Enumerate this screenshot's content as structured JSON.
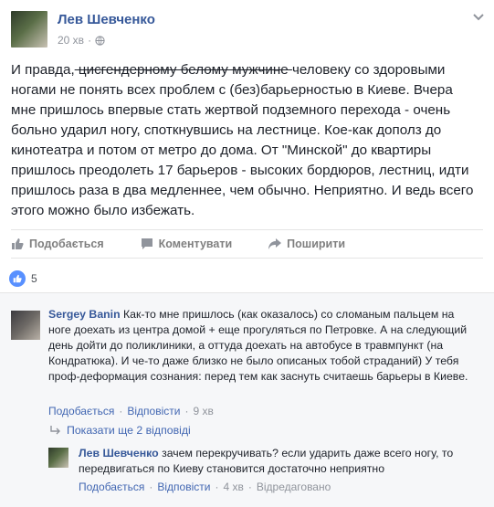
{
  "post": {
    "author": "Лев Шевченко",
    "time": "20 хв",
    "body": {
      "before_strike": "И правда,",
      "strike": " цисгендерному белому мужчине ",
      "after_strike": "человеку со здоровыми ногами не понять всех проблем с (без)барьерностью в Киеве. Вчера мне пришлось впервые стать жертвой подземного перехода - очень больно ударил ногу, споткнувшись на лестнице. Кое-как дополз до кинотеатра и потом от метро до дома. От \"Минской\" до квартиры пришлось преодолеть 17 барьеров - высоких бордюров, лестниц, идти пришлось раза в два медленнее, чем обычно. Неприятно. И ведь всего этого можно было избежать."
    },
    "actions": {
      "like": "Подобається",
      "comment": "Коментувати",
      "share": "Поширити"
    },
    "reaction_count": "5"
  },
  "comments": [
    {
      "author": "Sergey Banin",
      "text": "Как-то мне пришлось (как оказалось) со сломаным пальцем на ноге доехать из центра домой + еще прогуляться по Петровке. А на следующий день дойти до поликлиники, а оттуда доехать на автобусе в травмпункт (на Кондратюка). И че-то даже близко не было описаных тобой страданий) У тебя проф-деформация сознания: перед тем как заснуть считаешь барьеры в Киеве.",
      "like": "Подобається",
      "reply": "Відповісти",
      "time": "9 хв"
    }
  ],
  "show_more_replies": "Показати ще 2 відповіді",
  "reply": {
    "author": "Лев Шевченко",
    "text": "зачем перекручивать? если ударить даже всего ногу, то передвигаться по Киеву становится достаточно неприятно",
    "like": "Подобається",
    "reply": "Відповісти",
    "time": "4 хв",
    "edited": "Відредаговано"
  },
  "colors": {
    "link": "#365899",
    "muted": "#90949c",
    "like_blue": "#5890ff"
  },
  "icons": {
    "privacy": "globe-icon",
    "menu": "chevron-down-icon",
    "like": "thumbs-up-icon",
    "comment": "speech-bubble-icon",
    "share": "share-arrow-icon",
    "reaction": "like-reaction-icon",
    "more_replies": "reply-arrow-icon"
  }
}
